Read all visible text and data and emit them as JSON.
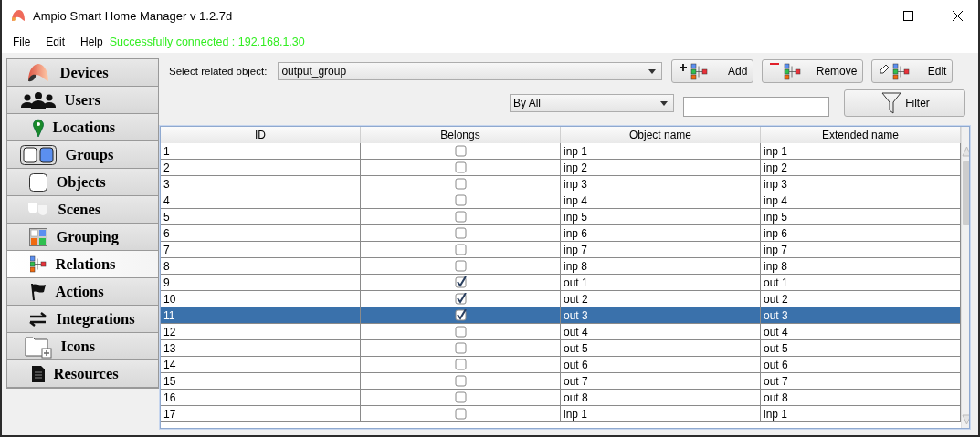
{
  "window": {
    "title": "Ampio Smart Home Manager v 1.2.7d"
  },
  "menu": [
    "File",
    "Edit",
    "Help"
  ],
  "status": "Successfully connected : 192.168.1.30",
  "sidebar": {
    "items": [
      {
        "label": "Devices",
        "selected": false
      },
      {
        "label": "Users",
        "selected": false
      },
      {
        "label": "Locations",
        "selected": false
      },
      {
        "label": "Groups",
        "selected": false
      },
      {
        "label": "Objects",
        "selected": false
      },
      {
        "label": "Scenes",
        "selected": false
      },
      {
        "label": "Grouping",
        "selected": false
      },
      {
        "label": "Relations",
        "selected": true
      },
      {
        "label": "Actions",
        "selected": false
      },
      {
        "label": "Integrations",
        "selected": false
      },
      {
        "label": "Icons",
        "selected": false
      },
      {
        "label": "Resources",
        "selected": false
      }
    ]
  },
  "related": {
    "label": "Select related object:",
    "value": "output_group"
  },
  "buttons": [
    "Add",
    "Remove",
    "Edit"
  ],
  "filter": {
    "mode": "By All",
    "button": "Filter"
  },
  "table": {
    "columns": [
      "ID",
      "Belongs",
      "Object name",
      "Extended name"
    ],
    "rows": [
      {
        "id": "1",
        "belongs": false,
        "object_name": "inp 1",
        "extended_name": "inp 1",
        "selected": false
      },
      {
        "id": "2",
        "belongs": false,
        "object_name": "inp 2",
        "extended_name": "inp 2",
        "selected": false
      },
      {
        "id": "3",
        "belongs": false,
        "object_name": "inp 3",
        "extended_name": "inp 3",
        "selected": false
      },
      {
        "id": "4",
        "belongs": false,
        "object_name": "inp 4",
        "extended_name": "inp 4",
        "selected": false
      },
      {
        "id": "5",
        "belongs": false,
        "object_name": "inp 5",
        "extended_name": "inp 5",
        "selected": false
      },
      {
        "id": "6",
        "belongs": false,
        "object_name": "inp 6",
        "extended_name": "inp 6",
        "selected": false
      },
      {
        "id": "7",
        "belongs": false,
        "object_name": "inp 7",
        "extended_name": "inp 7",
        "selected": false
      },
      {
        "id": "8",
        "belongs": false,
        "object_name": "inp 8",
        "extended_name": "inp 8",
        "selected": false
      },
      {
        "id": "9",
        "belongs": true,
        "object_name": "out 1",
        "extended_name": "out 1",
        "selected": false
      },
      {
        "id": "10",
        "belongs": true,
        "object_name": "out 2",
        "extended_name": "out 2",
        "selected": false
      },
      {
        "id": "11",
        "belongs": true,
        "object_name": "out 3",
        "extended_name": "out 3",
        "selected": true
      },
      {
        "id": "12",
        "belongs": false,
        "object_name": "out 4",
        "extended_name": "out 4",
        "selected": false
      },
      {
        "id": "13",
        "belongs": false,
        "object_name": "out 5",
        "extended_name": "out 5",
        "selected": false
      },
      {
        "id": "14",
        "belongs": false,
        "object_name": "out 6",
        "extended_name": "out 6",
        "selected": false
      },
      {
        "id": "15",
        "belongs": false,
        "object_name": "out 7",
        "extended_name": "out 7",
        "selected": false
      },
      {
        "id": "16",
        "belongs": false,
        "object_name": "out 8",
        "extended_name": "out 8",
        "selected": false
      },
      {
        "id": "17",
        "belongs": false,
        "object_name": "inp 1",
        "extended_name": "inp 1",
        "selected": false
      }
    ]
  }
}
